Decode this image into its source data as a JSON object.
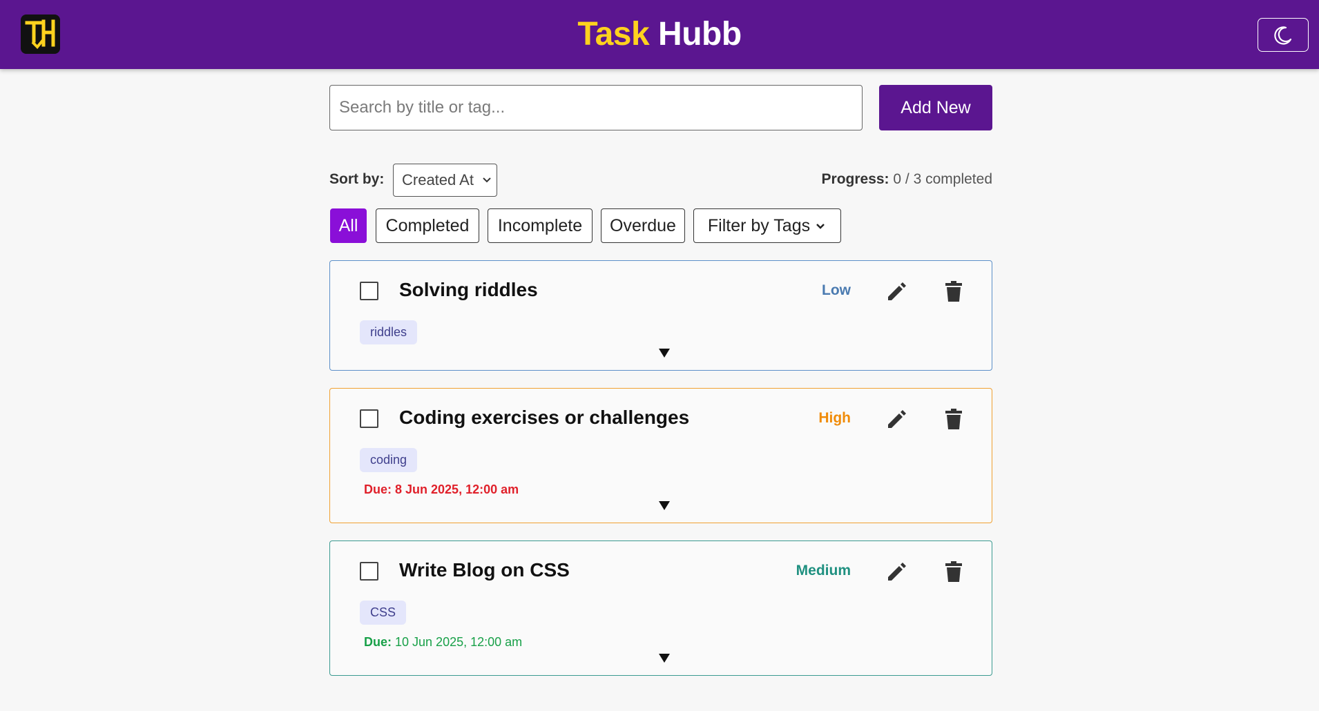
{
  "header": {
    "brand_part1": "Task",
    "brand_part2": "Hubb",
    "logo_text": "TH",
    "theme_toggle_icon": "moon-icon",
    "bg_color": "#5b1690",
    "brand_accent": "#ffd21e"
  },
  "search": {
    "placeholder": "Search by title or tag...",
    "value": ""
  },
  "add_button_label": "Add New",
  "sort": {
    "label": "Sort by:",
    "selected": "Created At"
  },
  "progress": {
    "label": "Progress:",
    "value": "0 / 3 completed"
  },
  "filters": [
    {
      "label": "All",
      "active": true
    },
    {
      "label": "Completed",
      "active": false
    },
    {
      "label": "Incomplete",
      "active": false
    },
    {
      "label": "Overdue",
      "active": false
    },
    {
      "label": "Filter by Tags",
      "active": false
    }
  ],
  "tasks": [
    {
      "title": "Solving riddles",
      "priority": "Low",
      "priority_color": "#4a7ab0",
      "border_color": "#5b8fc8",
      "tag": "riddles",
      "completed": false,
      "due_label": "",
      "due_value": ""
    },
    {
      "title": "Coding exercises or challenges",
      "priority": "High",
      "priority_color": "#f08c0a",
      "border_color": "#f0a030",
      "tag": "coding",
      "completed": false,
      "due_label": "Due:",
      "due_value": "8 Jun 2025, 12:00 am",
      "due_color": "#e0202a"
    },
    {
      "title": "Write Blog on CSS",
      "priority": "Medium",
      "priority_color": "#1f9080",
      "border_color": "#3a9a90",
      "tag": "CSS",
      "completed": false,
      "due_label": "Due:",
      "due_value": "10 Jun 2025, 12:00 am",
      "due_color": "#18a048"
    }
  ]
}
